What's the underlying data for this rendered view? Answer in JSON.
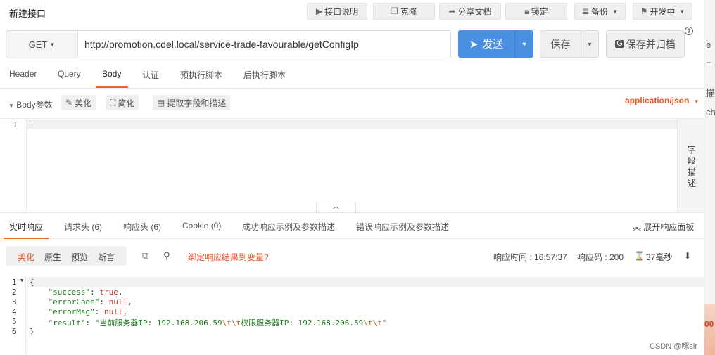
{
  "title": "新建接口",
  "toolbar": {
    "doc_label": "接口说明",
    "clone_label": "克隆",
    "share_label": "分享文档",
    "lock_label": "锁定",
    "backup_label": "备份",
    "status_label": "开发中"
  },
  "request": {
    "method": "GET",
    "url": "http://promotion.cdel.local/service-trade-favourable/getConfigIp",
    "send_label": "发送",
    "save_label": "保存",
    "save_archive_label": "保存并归档",
    "help_label": "?"
  },
  "request_tabs": [
    "Header",
    "Query",
    "Body",
    "认证",
    "预执行脚本",
    "后执行脚本"
  ],
  "active_request_tab": "Body",
  "body_toolbar": {
    "label": "Body参数",
    "beautify_label": "美化",
    "simplify_label": "简化",
    "extract_label": "提取字段和描述",
    "content_type": "application/json"
  },
  "editor": {
    "line_number": "1"
  },
  "field_desc_label": "字段描述",
  "response_tabs": {
    "realtime": "实时响应",
    "req_headers": "请求头 (6)",
    "resp_headers": "响应头 (6)",
    "cookie": "Cookie (0)",
    "success_example": "成功响应示例及参数描述",
    "error_example": "错误响应示例及参数描述",
    "expand": "展开响应面板"
  },
  "response_toolbar": {
    "pretty": "美化",
    "raw": "原生",
    "preview": "预览",
    "assert": "断言",
    "bind_var": "绑定响应结果到变量?",
    "time_label": "响应时间 : 16:57:37",
    "code_label": "响应码 : 200",
    "duration": "37毫秒"
  },
  "response_body": {
    "line_numbers": [
      "1",
      "2",
      "3",
      "4",
      "5",
      "6"
    ],
    "open_brace": "{",
    "close_brace": "}",
    "success_key": "\"success\"",
    "success_val": "true",
    "errorCode_key": "\"errorCode\"",
    "errorCode_val": "null",
    "errorMsg_key": "\"errorMsg\"",
    "errorMsg_val": "null",
    "result_key": "\"result\"",
    "result_part1": "\"当前服务器IP: 192.168.206.59",
    "result_esc1": "\\t\\t",
    "result_part2": "权限服务器IP: 192.168.206.59",
    "result_esc2": "\\t\\t",
    "result_end": "\""
  },
  "watermark": "CSDN @啄sir",
  "right_strip": {
    "frag1": "e",
    "frag2": "描",
    "frag3": "ch",
    "badge": "00"
  },
  "colors": {
    "accent": "#e8622c",
    "send_blue": "#4a90e2",
    "json_string": "#1a7d1a",
    "json_literal": "#c0392b"
  }
}
